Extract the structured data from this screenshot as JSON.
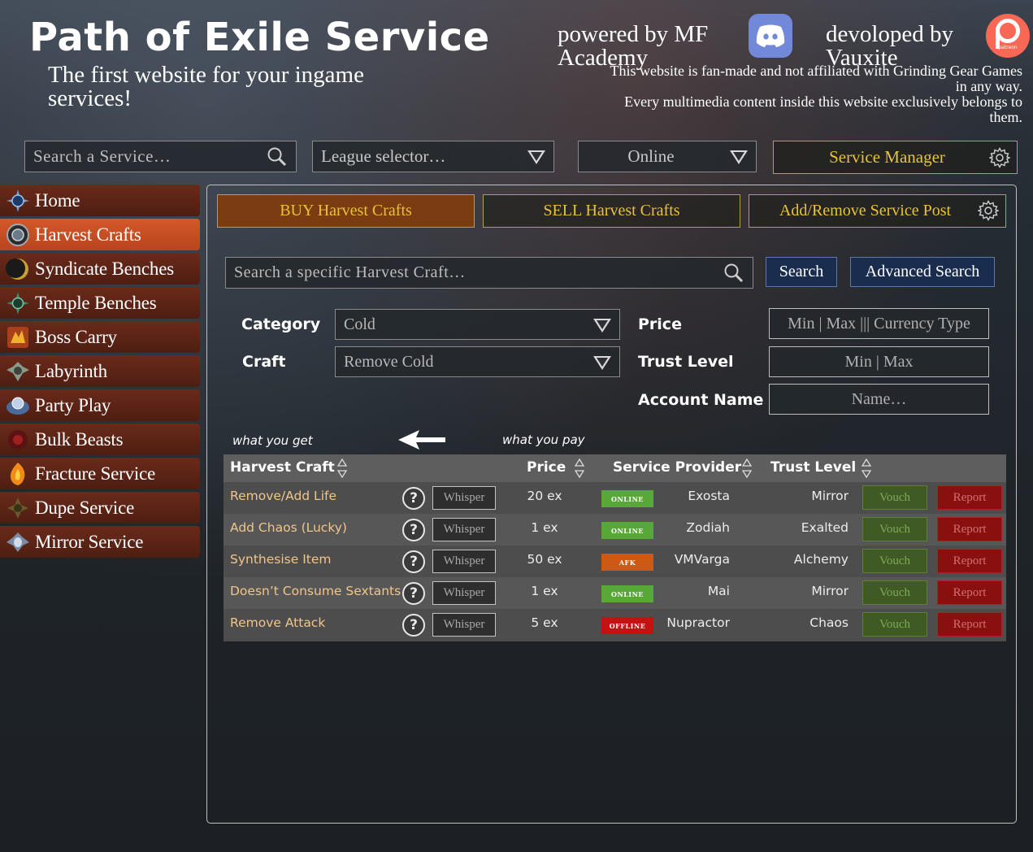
{
  "header": {
    "title": "Path of Exile Service",
    "subtitle": "The first website for your ingame services!",
    "powered_by": "powered by MF Academy",
    "developed_by": "devoloped by Vauxite",
    "patreon_text": "patreon",
    "disclaimer_line1": "This website is fan-made and not affiliated with Grinding Gear Games in any way.",
    "disclaimer_line2": "Every multimedia content inside this website exclusively belongs to them."
  },
  "top_controls": {
    "search_placeholder": "Search a Service…",
    "league_placeholder": "League selector…",
    "online_value": "Online",
    "service_manager": "Service Manager"
  },
  "sidebar": {
    "items": [
      {
        "label": "Home",
        "icon": "home-icon"
      },
      {
        "label": "Harvest Crafts",
        "icon": "harvest-icon"
      },
      {
        "label": "Syndicate Benches",
        "icon": "syndicate-icon"
      },
      {
        "label": "Temple Benches",
        "icon": "temple-icon"
      },
      {
        "label": "Boss Carry",
        "icon": "boss-icon"
      },
      {
        "label": "Labyrinth",
        "icon": "labyrinth-icon"
      },
      {
        "label": "Party Play",
        "icon": "party-icon"
      },
      {
        "label": "Bulk Beasts",
        "icon": "beast-icon"
      },
      {
        "label": "Fracture Service",
        "icon": "fracture-icon"
      },
      {
        "label": "Dupe Service",
        "icon": "dupe-icon"
      },
      {
        "label": "Mirror Service",
        "icon": "mirror-icon"
      }
    ],
    "active": "Harvest Crafts"
  },
  "tabs": {
    "buy": "BUY Harvest Crafts",
    "sell": "SELL Harvest Crafts",
    "add_remove": "Add/Remove Service Post"
  },
  "search": {
    "placeholder": "Search a specific Harvest Craft…",
    "search_button": "Search",
    "advanced_button": "Advanced Search"
  },
  "filters": {
    "category_label": "Category",
    "category_value": "Cold",
    "craft_label": "Craft",
    "craft_value": "Remove Cold",
    "price_label": "Price",
    "price_placeholder": "Min | Max ||| Currency Type",
    "trust_label": "Trust Level",
    "trust_placeholder": "Min | Max",
    "account_label": "Account Name",
    "account_placeholder": "Name…"
  },
  "hints": {
    "get": "what you get",
    "pay": "what you pay"
  },
  "table": {
    "columns": {
      "craft": "Harvest Craft",
      "price": "Price",
      "provider": "Service Provider",
      "trust": "Trust Level"
    },
    "whisper_label": "Whisper",
    "vouch_label": "Vouch",
    "report_label": "Report",
    "qmark": "?",
    "rows": [
      {
        "craft": "Remove/Add Life",
        "price": "20 ex",
        "status": "ONLINE",
        "provider": "Exosta",
        "trust": "Mirror"
      },
      {
        "craft": "Add Chaos (Lucky)",
        "price": "1 ex",
        "status": "ONLINE",
        "provider": "Zodiah",
        "trust": "Exalted"
      },
      {
        "craft": "Synthesise Item",
        "price": "50 ex",
        "status": "AFK",
        "provider": "VMVarga",
        "trust": "Alchemy"
      },
      {
        "craft": "Doesn’t Consume Sextants",
        "price": "1 ex",
        "status": "ONLINE",
        "provider": "Mai",
        "trust": "Mirror"
      },
      {
        "craft": "Remove Attack",
        "price": "5 ex",
        "status": "OFFLINE",
        "provider": "Nupractor",
        "trust": "Chaos"
      }
    ]
  },
  "colors": {
    "online": "#58a839",
    "afk": "#cc5a14",
    "offline": "#c41212",
    "accent_gold": "#e8c23a",
    "active_nav": "#c84f22"
  }
}
